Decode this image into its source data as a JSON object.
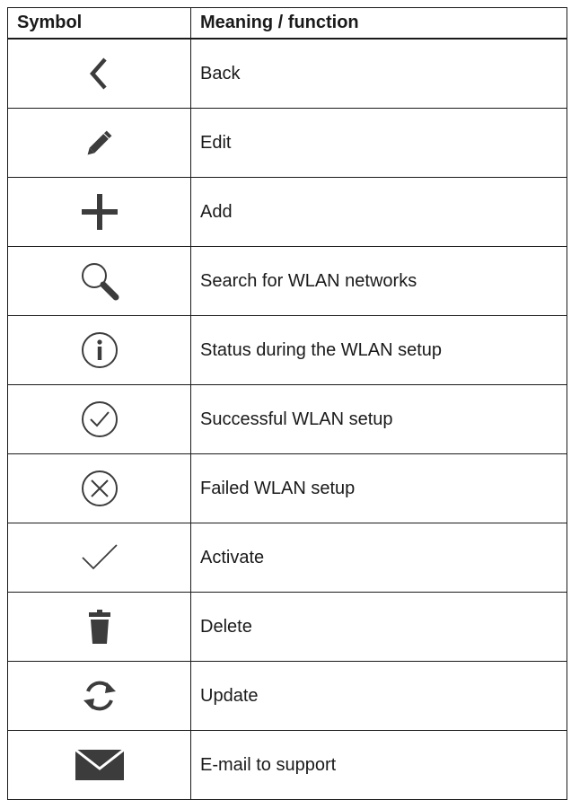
{
  "table": {
    "header": {
      "symbol": "Symbol",
      "meaning": "Meaning / function"
    },
    "rows": [
      {
        "icon": "back-chevron-icon",
        "meaning": "Back"
      },
      {
        "icon": "pencil-icon",
        "meaning": "Edit"
      },
      {
        "icon": "plus-icon",
        "meaning": "Add"
      },
      {
        "icon": "search-icon",
        "meaning": "Search for WLAN networks"
      },
      {
        "icon": "info-circle-icon",
        "meaning": "Status during the WLAN setup"
      },
      {
        "icon": "check-circle-icon",
        "meaning": "Successful WLAN setup"
      },
      {
        "icon": "x-circle-icon",
        "meaning": "Failed WLAN setup"
      },
      {
        "icon": "checkmark-icon",
        "meaning": "Activate"
      },
      {
        "icon": "trash-icon",
        "meaning": "Delete"
      },
      {
        "icon": "refresh-icon",
        "meaning": "Update"
      },
      {
        "icon": "envelope-icon",
        "meaning": "E-mail to support"
      }
    ]
  },
  "colors": {
    "icon": "#3c3c3c",
    "border": "#1a1a1a",
    "text": "#1a1a1a"
  }
}
